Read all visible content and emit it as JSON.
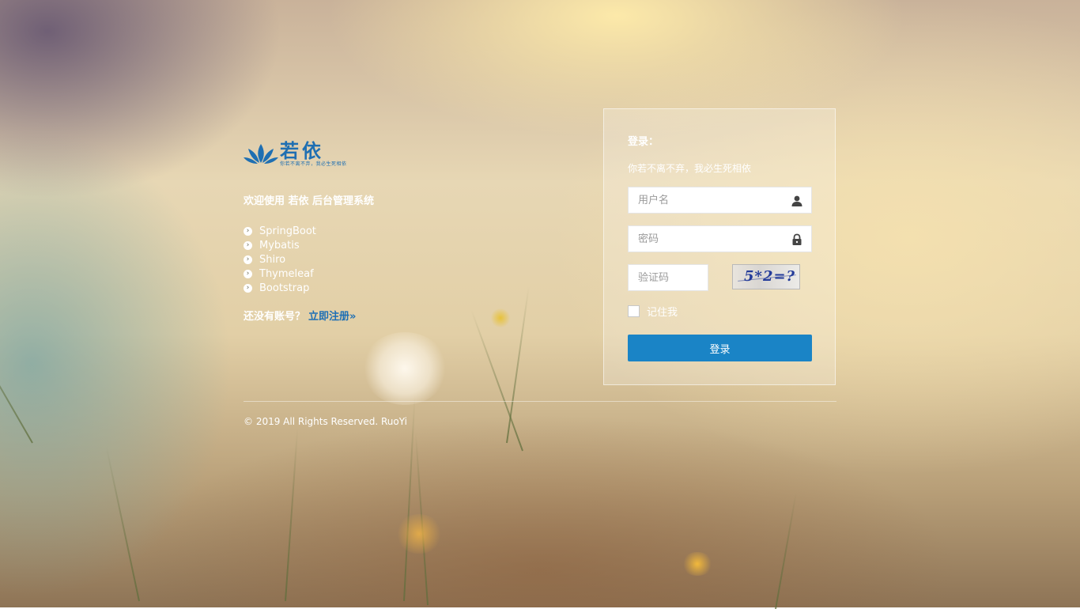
{
  "brand": {
    "logo_text": "若依",
    "logo_sub": "你若不离不弃，我必生死相依"
  },
  "left": {
    "welcome": "欢迎使用 若依 后台管理系统",
    "tech": [
      "SpringBoot",
      "Mybatis",
      "Shiro",
      "Thymeleaf",
      "Bootstrap"
    ],
    "no_account": "还没有账号？",
    "register_link": "立即注册»"
  },
  "login": {
    "title": "登录：",
    "subtitle": "你若不离不弃，我必生死相依",
    "username_placeholder": "用户名",
    "password_placeholder": "密码",
    "captcha_placeholder": "验证码",
    "captcha_text": "5*2=?",
    "remember_label": "记住我",
    "submit_label": "登录"
  },
  "footer": {
    "copyright": "© 2019 All Rights Reserved. RuoYi"
  },
  "colors": {
    "brand_blue": "#1f6fb2",
    "button_blue": "#1a84c6",
    "link_blue": "#1e6fb5"
  },
  "icons": {
    "username": "user-icon",
    "password": "lock-icon",
    "list_bullet": "circle-arrow-right-icon"
  }
}
